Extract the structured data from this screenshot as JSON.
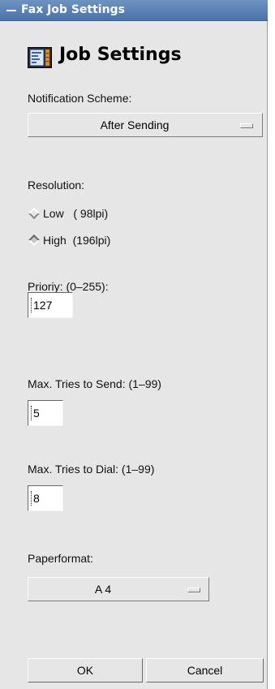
{
  "window": {
    "title": "Fax Job Settings"
  },
  "header": {
    "title": "Job Settings",
    "icon": "fax-settings-icon"
  },
  "notification": {
    "label": "Notification Scheme:",
    "selected": "After Sending"
  },
  "resolution": {
    "label": "Resolution:",
    "options": [
      {
        "label": "Low   ( 98lpi)",
        "checked": false
      },
      {
        "label": "High  (196lpi)",
        "checked": true
      }
    ]
  },
  "priority": {
    "label": "Prioriy: (0–255):",
    "value": "127"
  },
  "tries_send": {
    "label": "Max. Tries to Send: (1–99)",
    "value": "5"
  },
  "tries_dial": {
    "label": "Max. Tries to Dial: (1–99)",
    "value": "8"
  },
  "paper": {
    "label": "Paperformat:",
    "selected": "A 4"
  },
  "buttons": {
    "ok": "OK",
    "cancel": "Cancel"
  }
}
